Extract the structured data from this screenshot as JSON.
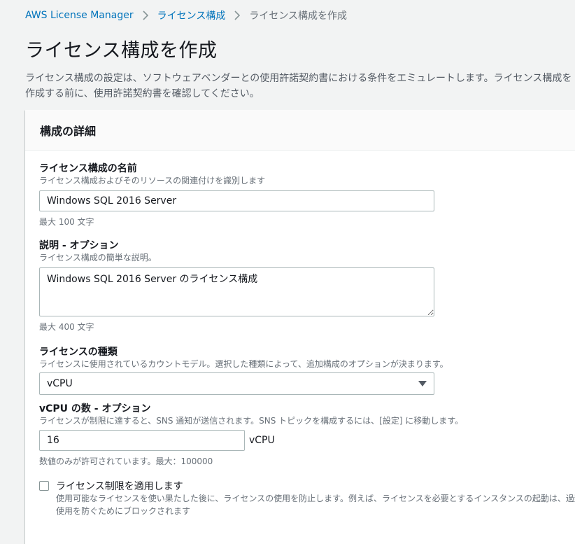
{
  "breadcrumb": {
    "items": [
      "AWS License Manager",
      "ライセンス構成",
      "ライセンス構成を作成"
    ]
  },
  "page": {
    "title": "ライセンス構成を作成",
    "description": "ライセンス構成の設定は、ソフトウェアベンダーとの使用許諾契約書における条件をエミュレートします。ライセンス構成を作成する前に、使用許諾契約書を確認してください。"
  },
  "panel": {
    "title": "構成の詳細"
  },
  "form": {
    "name": {
      "label": "ライセンス構成の名前",
      "description": "ライセンス構成およびそのリソースの関連付けを識別します",
      "value": "Windows SQL 2016 Server",
      "hint": "最大 100 文字"
    },
    "description": {
      "label": "説明 - オプション",
      "description": "ライセンス構成の簡単な説明。",
      "value": "Windows SQL 2016 Server のライセンス構成",
      "hint": "最大 400 文字"
    },
    "license_type": {
      "label": "ライセンスの種類",
      "description": "ライセンスに使用されているカウントモデル。選択した種類によって、追加構成のオプションが決まります。",
      "selected": "vCPU"
    },
    "vcpu_count": {
      "label": "vCPU の数 - オプション",
      "description": "ライセンスが制限に達すると、SNS 通知が送信されます。SNS トピックを構成するには、[設定] に移動します。",
      "value": "16",
      "unit": "vCPU",
      "hint": "数値のみが許可されています。最大：100000"
    },
    "enforce_limit": {
      "label": "ライセンス制限を適用します",
      "description": "使用可能なライセンスを使い果たした後に、ライセンスの使用を防止します。例えば、ライセンスを必要とするインスタンスの起動は、過剰使用を防ぐためにブロックされます",
      "checked": false
    }
  },
  "colors": {
    "link": "#0073bb",
    "background": "#f2f3f3",
    "panel": "#ffffff",
    "border": "#aab7b8"
  },
  "icons": {
    "breadcrumb_separator": "chevron-right-icon",
    "select_caret": "caret-down-icon"
  }
}
